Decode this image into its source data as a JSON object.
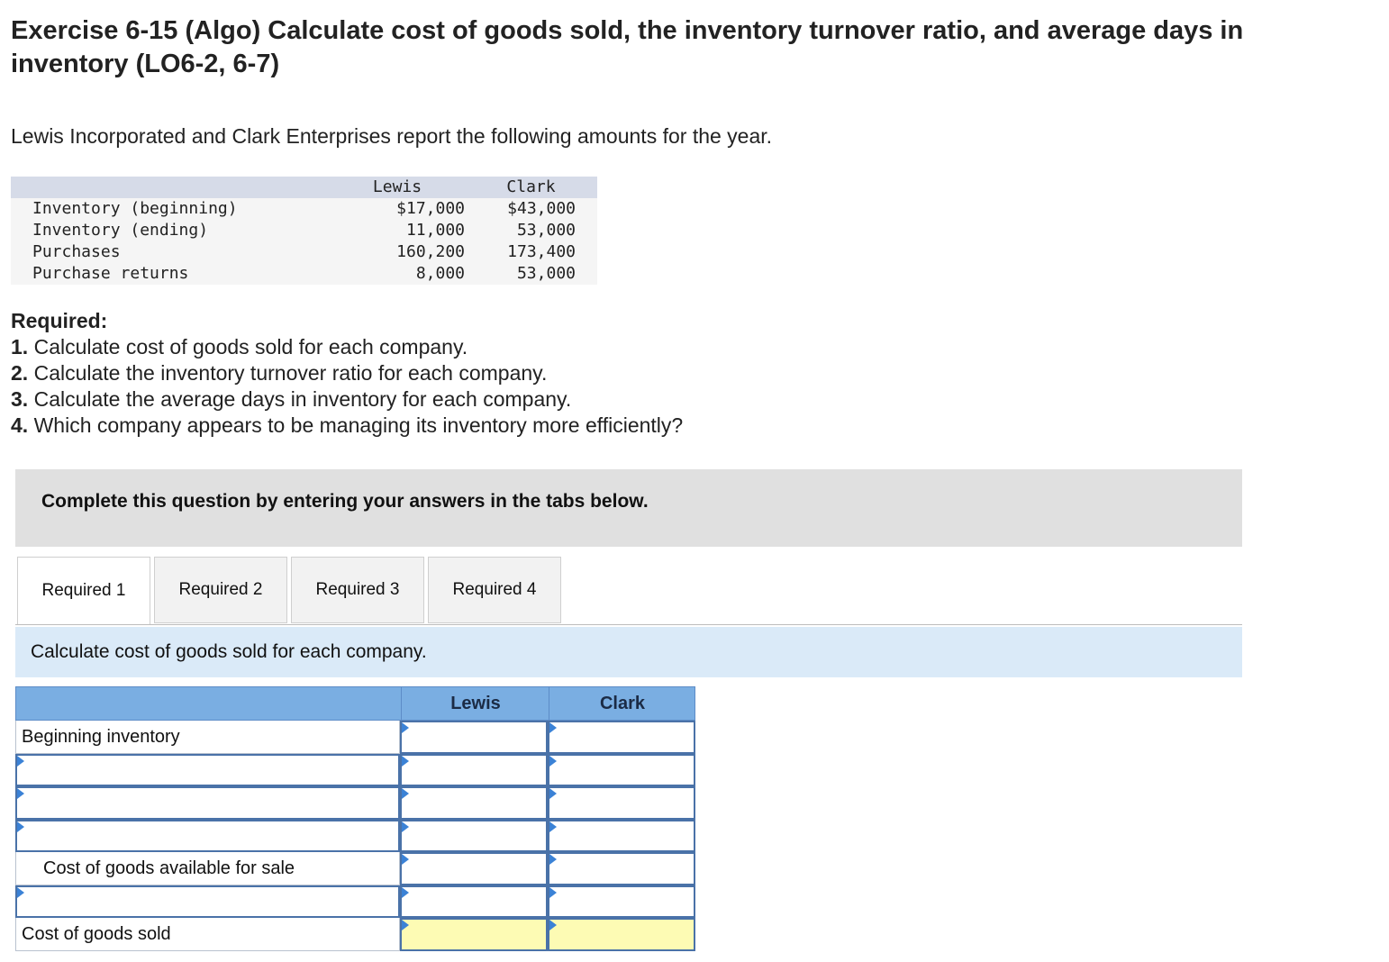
{
  "header": {
    "title": "Exercise 6-15 (Algo) Calculate cost of goods sold, the inventory turnover ratio, and average days in inventory (LO6-2, 6-7)",
    "intro": "Lewis Incorporated and Clark Enterprises report the following amounts for the year."
  },
  "data_table": {
    "col_lewis": "Lewis",
    "col_clark": "Clark",
    "rows": [
      {
        "label": "Inventory (beginning)",
        "lewis": "$17,000",
        "clark": "$43,000"
      },
      {
        "label": "Inventory (ending)",
        "lewis": "11,000",
        "clark": "53,000"
      },
      {
        "label": "Purchases",
        "lewis": "160,200",
        "clark": "173,400"
      },
      {
        "label": "Purchase returns",
        "lewis": "8,000",
        "clark": "53,000"
      }
    ]
  },
  "required": {
    "heading": "Required:",
    "items": [
      {
        "num": "1.",
        "text": " Calculate cost of goods sold for each company."
      },
      {
        "num": "2.",
        "text": " Calculate the inventory turnover ratio for each company."
      },
      {
        "num": "3.",
        "text": " Calculate the average days in inventory for each company."
      },
      {
        "num": "4.",
        "text": " Which company appears to be managing its inventory more efficiently?"
      }
    ]
  },
  "instruction": "Complete this question by entering your answers in the tabs below.",
  "tabs": [
    {
      "label": "Required 1",
      "active": true
    },
    {
      "label": "Required 2",
      "active": false
    },
    {
      "label": "Required 3",
      "active": false
    },
    {
      "label": "Required 4",
      "active": false
    }
  ],
  "tab_description": "Calculate cost of goods sold for each company.",
  "cogs_table": {
    "col_lewis": "Lewis",
    "col_clark": "Clark",
    "rows": [
      {
        "label": "Beginning inventory",
        "type": "text",
        "indent": false
      },
      {
        "label": "",
        "type": "input"
      },
      {
        "label": "",
        "type": "input"
      },
      {
        "label": "",
        "type": "input"
      },
      {
        "label": "Cost of goods available for sale",
        "type": "text",
        "indent": true
      },
      {
        "label": "",
        "type": "input"
      },
      {
        "label": "Cost of goods sold",
        "type": "text",
        "indent": false,
        "highlight": true
      }
    ]
  },
  "colors": {
    "header_blue": "#7aaee2",
    "tab_desc_bg": "#daeaf8",
    "highlight_yellow": "#fdfbb4",
    "instruction_bg": "#e0e0e0"
  }
}
